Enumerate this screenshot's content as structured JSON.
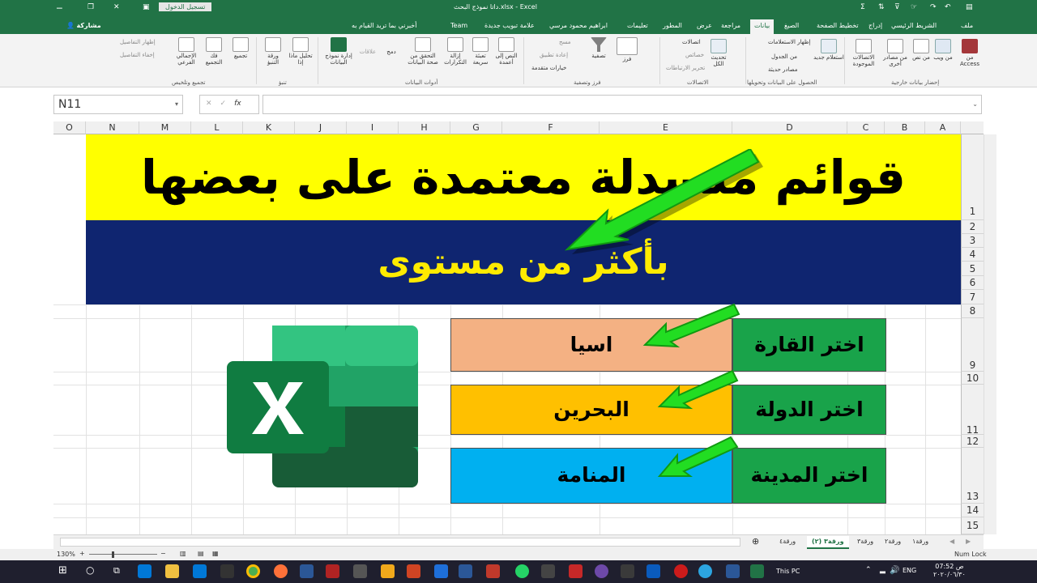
{
  "titlebar": {
    "title": "داتا نموذج البحث.xlsx - Excel",
    "signin": "تسجيل الدخول"
  },
  "tabs": [
    "ملف",
    "الشريط الرئيسي",
    "إدراج",
    "تخطيط الصفحة",
    "الصيغ",
    "بيانات",
    "مراجعة",
    "عرض",
    "المطور",
    "تعليمات",
    "ابراهيم محمود مرسي",
    "علامة تبويب جديدة",
    "Team",
    "أخبرني بما تريد القيام به"
  ],
  "tabs_share": "مشاركة",
  "ribbon": {
    "btn_access": "من Access",
    "btn_web": "من ويب",
    "btn_text": "من نص",
    "btn_other": "من مصادر أخرى",
    "btn_existing": "الاتصالات الموجودة",
    "btn_newquery": "استعلام جديد",
    "sm_showqueries": "إظهار الاستعلامات",
    "sm_fromtable": "من الجدول",
    "sm_recent": "مصادر حديثة",
    "btn_refresh": "تحديث الكل",
    "sm_connections": "اتصالات",
    "sm_properties": "خصائص",
    "sm_editlinks": "تحرير الارتباطات",
    "btn_sort": "فرز",
    "btn_filter": "تصفية",
    "sm_clear": "مسح",
    "sm_reapply": "إعادة تطبيق",
    "sm_advanced": "خيارات متقدمة",
    "btn_textcols": "النص إلى أعمدة",
    "btn_flash": "تعبئة سريعة",
    "btn_dup": "إزالة التكرارات",
    "btn_validate": "التحقق من صحة البيانات",
    "btn_merge": "دمج",
    "btn_relations": "علاقات",
    "btn_model": "إدارة نموذج البيانات",
    "btn_whatif": "تحليل ماذا إذا",
    "btn_forecast": "ورقة التنبؤ",
    "btn_group": "تجميع",
    "btn_ungroup": "فك التجميع",
    "btn_subtotal": "الإجمالي الفرعي",
    "sm_show": "إظهار التفاصيل",
    "sm_hide": "إخفاء التفاصيل",
    "g_external": "إحضار بيانات خارجية",
    "g_gettransform": "الحصول على البيانات وتحويلها",
    "g_connections": "الاتصالات",
    "g_sortfilter": "فرز وتصفية",
    "g_datatools": "أدوات البيانات",
    "g_forecast": "تنبؤ",
    "g_outline": "تجميع وتلخيص"
  },
  "formula": {
    "namebox": "N11",
    "fx": "fx"
  },
  "columns": [
    "O",
    "N",
    "M",
    "L",
    "K",
    "J",
    "I",
    "H",
    "G",
    "F",
    "E",
    "D",
    "C",
    "B",
    "A"
  ],
  "rows": [
    "1",
    "2",
    "3",
    "4",
    "5",
    "6",
    "7",
    "8",
    "9",
    "10",
    "11",
    "12",
    "13",
    "14",
    "15"
  ],
  "sheet": {
    "title": "قوائم منسدلة معتمدة على بعضها",
    "subtitle": "بأكثر من مستوى",
    "lists": [
      {
        "label": "اختر القارة",
        "value": "اسيا",
        "color": "#f4b183"
      },
      {
        "label": "اختر الدولة",
        "value": "البحرين",
        "color": "#ffc000"
      },
      {
        "label": "اختر المدينة",
        "value": "المنامة",
        "color": "#00b0f0"
      }
    ]
  },
  "sheet_tabs": [
    "ورقة١",
    "ورقة٢",
    "ورقة٣",
    "ورقة٣ (٢)",
    "ورقة٤"
  ],
  "status": {
    "zoom": "130%",
    "numlock": "Num Lock"
  },
  "taskbar": {
    "thispc": "This PC",
    "lang": "ENG",
    "time": "07:52 ص",
    "date": "٢٠٢٠/٠٦/٣٠"
  },
  "colors": {
    "excel_green": "#217346",
    "title_bg": "#ffff00",
    "subtitle_bg": "#0f2570",
    "label_bg": "#19a34a"
  }
}
